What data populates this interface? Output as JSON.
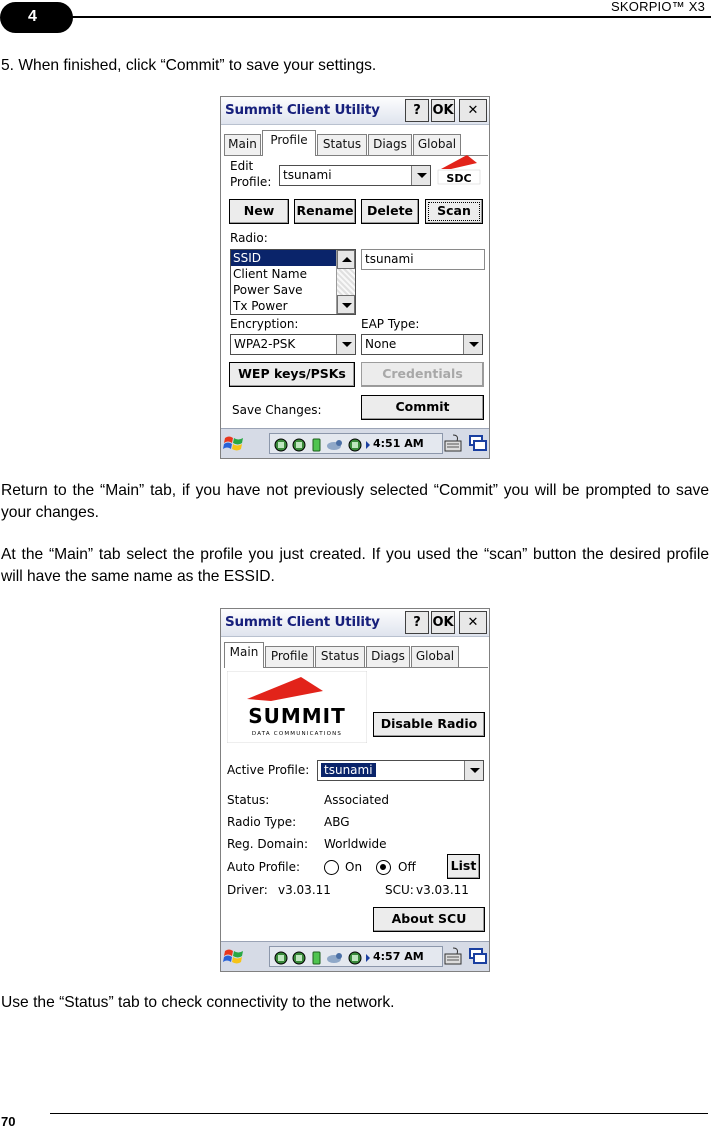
{
  "page": {
    "chapter_number": "4",
    "header_title": "SKORPIO™ X3",
    "page_number": "70",
    "step5": "5.    When finished, click “Commit” to save your settings.",
    "para_return": "Return to the “Main” tab, if you have not previously selected “Commit” you will be prompted to save your changes.",
    "para_main": "At the “Main” tab select the profile you just created. If you used the “scan” button the desired profile will have the same name as the ESSID.",
    "para_status": "Use the “Status” tab to check connectivity to the network."
  },
  "profile_screen": {
    "title": "Summit Client Utility",
    "help_label": "?",
    "ok_label": "OK",
    "close_label": "✕",
    "tabs": [
      "Main",
      "Profile",
      "Status",
      "Diags",
      "Global"
    ],
    "active_tab": "Profile",
    "edit_profile_label_1": "Edit",
    "edit_profile_label_2": "Profile:",
    "edit_profile_value": "tsunami",
    "logo_text": "SDC",
    "buttons": {
      "new": "New",
      "rename": "Rename",
      "delete": "Delete",
      "scan": "Scan"
    },
    "radio_label": "Radio:",
    "radio_items": [
      "SSID",
      "Client Name",
      "Power Save",
      "Tx Power"
    ],
    "radio_selected": "SSID",
    "radio_value": "tsunami",
    "encryption_label": "Encryption:",
    "encryption_value": "WPA2-PSK",
    "eap_label": "EAP Type:",
    "eap_value": "None",
    "wep_button": "WEP keys/PSKs",
    "credentials_button": "Credentials",
    "save_changes_label": "Save Changes:",
    "commit_button": "Commit",
    "clock": "4:51 AM"
  },
  "main_screen": {
    "title": "Summit Client Utility",
    "help_label": "?",
    "ok_label": "OK",
    "close_label": "✕",
    "tabs": [
      "Main",
      "Profile",
      "Status",
      "Diags",
      "Global"
    ],
    "active_tab": "Main",
    "logo_word": "SUMMIT",
    "logo_sub": "DATA COMMUNICATIONS",
    "disable_radio_button": "Disable Radio",
    "active_profile_label": "Active Profile:",
    "active_profile_value": "tsunami",
    "status_label": "Status:",
    "status_value": "Associated",
    "radio_type_label": "Radio Type:",
    "radio_type_value": "ABG",
    "reg_domain_label": "Reg. Domain:",
    "reg_domain_value": "Worldwide",
    "auto_profile_label": "Auto Profile:",
    "auto_on_label": "On",
    "auto_off_label": "Off",
    "auto_profile_selected": "Off",
    "list_button": "List",
    "driver_label": "Driver:",
    "driver_value": "v3.03.11",
    "scu_label": "SCU:",
    "scu_value": "v3.03.11",
    "about_button": "About SCU",
    "clock": "4:57 AM"
  },
  "colors": {
    "selection": "#0a246a",
    "title_text": "#17207c",
    "logo_red": "#e2231a"
  }
}
